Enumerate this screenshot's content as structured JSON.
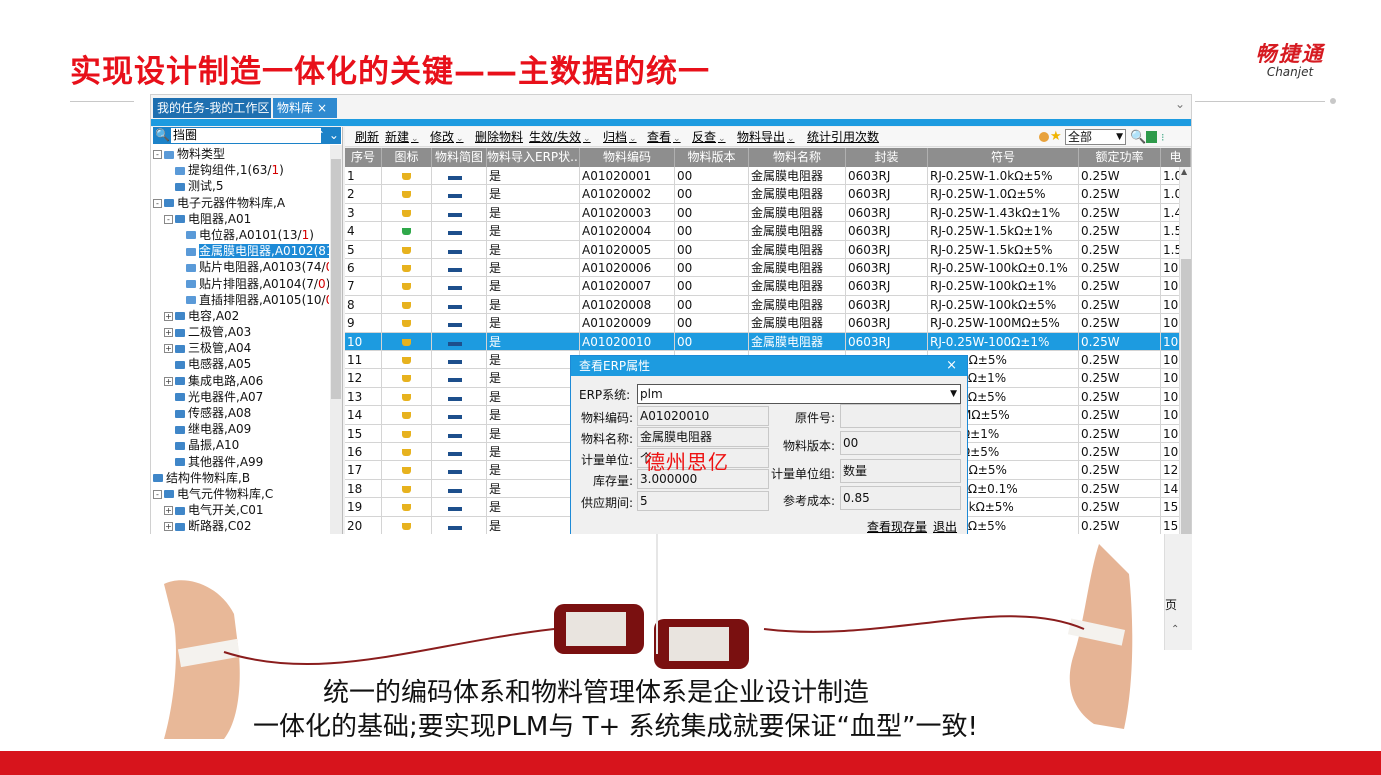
{
  "slide": {
    "title": "实现设计制造一体化的关键——主数据的统一",
    "logo_cn": "畅捷通",
    "logo_en": "Chanjet",
    "caption_line1": "统一的编码体系和物料管理体系是企业设计制造",
    "caption_line2": "一体化的基础;要实现PLM与 T+ 系统集成就要保证“血型”一致!",
    "watermark": "德州思亿",
    "side_label": "页",
    "colors": {
      "brand_red": "#e8101a",
      "tab_blue": "#1e6fb0",
      "highlight_blue": "#1d9be0"
    }
  },
  "tabs": [
    {
      "label": "我的任务-我的工作区"
    },
    {
      "label": "物料库",
      "close": "×"
    }
  ],
  "tree": {
    "search_icon": "search-icon",
    "search_value": "挡圈",
    "search_buttons": "⌃ ⌄",
    "nodes": [
      {
        "label": "物料类型",
        "extra": "",
        "tail": ""
      },
      {
        "label": "提钩组件,1(63/",
        "extra": "1",
        "tail": ")"
      },
      {
        "label": "测试,5",
        "extra": "",
        "tail": ""
      },
      {
        "label": "电子元器件物料库,A",
        "extra": "",
        "tail": ""
      },
      {
        "label": "电阻器,A01",
        "extra": "",
        "tail": ""
      },
      {
        "label": "电位器,A0101(13/",
        "extra": "1",
        "tail": ")"
      },
      {
        "label": "金属膜电阻器,A0102(81/",
        "extra": "",
        "tail": ""
      },
      {
        "label": "贴片电阻器,A0103(74/",
        "extra": "0",
        "tail": ")"
      },
      {
        "label": "贴片排阻器,A0104(7/",
        "extra": "0",
        "tail": ")"
      },
      {
        "label": "直插排阻器,A0105(10/",
        "extra": "0",
        "tail": ")"
      },
      {
        "label": "电容,A02",
        "extra": "",
        "tail": ""
      },
      {
        "label": "二极管,A03",
        "extra": "",
        "tail": ""
      },
      {
        "label": "三极管,A04",
        "extra": "",
        "tail": ""
      },
      {
        "label": "电感器,A05",
        "extra": "",
        "tail": ""
      },
      {
        "label": "集成电路,A06",
        "extra": "",
        "tail": ""
      },
      {
        "label": "光电器件,A07",
        "extra": "",
        "tail": ""
      },
      {
        "label": "传感器,A08",
        "extra": "",
        "tail": ""
      },
      {
        "label": "继电器,A09",
        "extra": "",
        "tail": ""
      },
      {
        "label": "晶振,A10",
        "extra": "",
        "tail": ""
      },
      {
        "label": "其他器件,A99",
        "extra": "",
        "tail": ""
      },
      {
        "label": "结构件物料库,B",
        "extra": "",
        "tail": ""
      },
      {
        "label": "电气元件物料库,C",
        "extra": "",
        "tail": ""
      },
      {
        "label": "电气开关,C01",
        "extra": "",
        "tail": ""
      },
      {
        "label": "断路器,C02",
        "extra": "",
        "tail": ""
      }
    ]
  },
  "toolbar": {
    "buttons": [
      "刷新",
      "新建",
      "修改",
      "删除物料",
      "生效/失效",
      "归档",
      "查看",
      "反查",
      "物料导出",
      "统计引用次数"
    ],
    "caret": "⌄",
    "scope_value": "全部"
  },
  "grid": {
    "columns": [
      "序号",
      "图标",
      "物料简图",
      "物料导入ERP状...",
      "物料编码",
      "物料版本",
      "物料名称",
      "封装",
      "符号",
      "额定功率",
      "电"
    ],
    "rows": [
      [
        "1",
        "",
        "",
        "是",
        "A01020001",
        "00",
        "金属膜电阻器",
        "0603RJ",
        "RJ-0.25W-1.0kΩ±5%",
        "0.25W",
        "1.0"
      ],
      [
        "2",
        "",
        "",
        "是",
        "A01020002",
        "00",
        "金属膜电阻器",
        "0603RJ",
        "RJ-0.25W-1.0Ω±5%",
        "0.25W",
        "1.0"
      ],
      [
        "3",
        "",
        "",
        "是",
        "A01020003",
        "00",
        "金属膜电阻器",
        "0603RJ",
        "RJ-0.25W-1.43kΩ±1%",
        "0.25W",
        "1.4"
      ],
      [
        "4",
        "",
        "",
        "是",
        "A01020004",
        "00",
        "金属膜电阻器",
        "0603RJ",
        "RJ-0.25W-1.5kΩ±1%",
        "0.25W",
        "1.5"
      ],
      [
        "5",
        "",
        "",
        "是",
        "A01020005",
        "00",
        "金属膜电阻器",
        "0603RJ",
        "RJ-0.25W-1.5kΩ±5%",
        "0.25W",
        "1.5"
      ],
      [
        "6",
        "",
        "",
        "是",
        "A01020006",
        "00",
        "金属膜电阻器",
        "0603RJ",
        "RJ-0.25W-100kΩ±0.1%",
        "0.25W",
        "100"
      ],
      [
        "7",
        "",
        "",
        "是",
        "A01020007",
        "00",
        "金属膜电阻器",
        "0603RJ",
        "RJ-0.25W-100kΩ±1%",
        "0.25W",
        "100"
      ],
      [
        "8",
        "",
        "",
        "是",
        "A01020008",
        "00",
        "金属膜电阻器",
        "0603RJ",
        "RJ-0.25W-100kΩ±5%",
        "0.25W",
        "100"
      ],
      [
        "9",
        "",
        "",
        "是",
        "A01020009",
        "00",
        "金属膜电阻器",
        "0603RJ",
        "RJ-0.25W-100MΩ±5%",
        "0.25W",
        "100"
      ],
      [
        "10",
        "",
        "",
        "是",
        "A01020010",
        "00",
        "金属膜电阻器",
        "0603RJ",
        "RJ-0.25W-100Ω±1%",
        "0.25W",
        "100"
      ],
      [
        "11",
        "",
        "",
        "是",
        "",
        "",
        "",
        "",
        "W-100Ω±5%",
        "0.25W",
        "100"
      ],
      [
        "12",
        "",
        "",
        "是",
        "",
        "",
        "",
        "",
        "W-10kΩ±1%",
        "0.25W",
        "10k"
      ],
      [
        "13",
        "",
        "",
        "是",
        "",
        "",
        "",
        "",
        "W-10kΩ±5%",
        "0.25W",
        "10k"
      ],
      [
        "14",
        "",
        "",
        "是",
        "",
        "",
        "",
        "",
        "W-10MΩ±5%",
        "0.25W",
        "10M"
      ],
      [
        "15",
        "",
        "",
        "是",
        "",
        "",
        "",
        "",
        "W-10Ω±1%",
        "0.25W",
        "100"
      ],
      [
        "16",
        "",
        "",
        "是",
        "",
        "",
        "",
        "",
        "W-10Ω±5%",
        "0.25W",
        "100"
      ],
      [
        "17",
        "",
        "",
        "是",
        "",
        "",
        "",
        "",
        "W-120Ω±5%",
        "0.25W",
        "120"
      ],
      [
        "18",
        "",
        "",
        "是",
        "",
        "",
        "",
        "",
        "W-14kΩ±0.1%",
        "0.25W",
        "14k"
      ],
      [
        "19",
        "",
        "",
        "是",
        "",
        "",
        "",
        "",
        "W-150kΩ±5%",
        "0.25W",
        "150"
      ],
      [
        "20",
        "",
        "",
        "是",
        "",
        "",
        "",
        "",
        "W-15kΩ±5%",
        "0.25W",
        "15k"
      ]
    ],
    "green_icon_row": 4,
    "highlight_row": 10
  },
  "dialog": {
    "title": "查看ERP属性",
    "close": "×",
    "erp_system_label": "ERP系统:",
    "erp_system_value": "plm",
    "code_label": "物料编码:",
    "code_value": "A01020010",
    "orig_part_label": "原件号:",
    "orig_part_value": "",
    "name_label": "物料名称:",
    "name_value": "金属膜电阻器",
    "version_label": "物料版本:",
    "version_value": "00",
    "unit_label": "计量单位:",
    "unit_value": "个",
    "unit_group_label": "计量单位组:",
    "unit_group_value": "数量",
    "stock_label": "库存量:",
    "stock_value": "3.000000",
    "ref_cost_label": "参考成本:",
    "ref_cost_value": "0.85",
    "supply_label": "供应期间:",
    "supply_value": "5",
    "view_stock_link": "查看现存量",
    "exit_link": "退出"
  }
}
